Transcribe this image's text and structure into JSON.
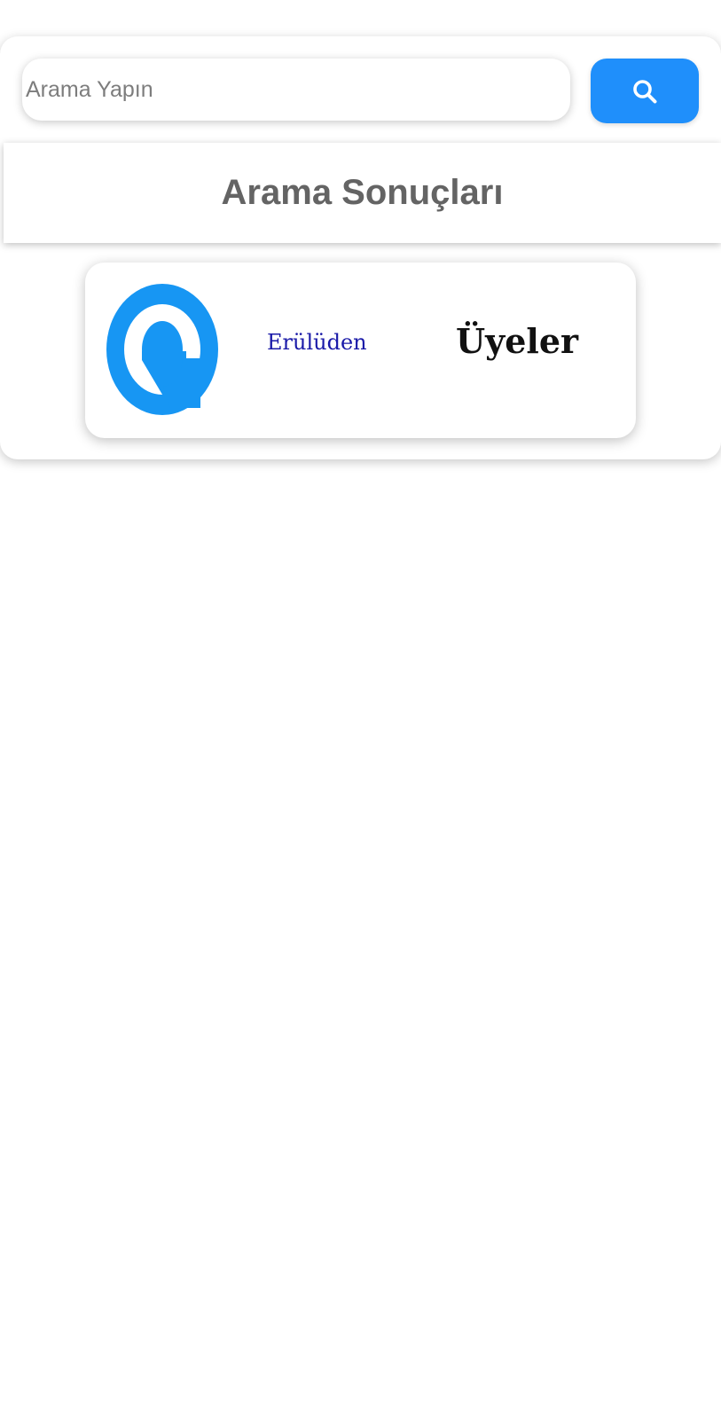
{
  "search": {
    "placeholder": "Arama Yapın",
    "value": "",
    "button_icon": "search-icon",
    "button_color": "#1f8ffb"
  },
  "results": {
    "title": "Arama Sonuçları",
    "items": [
      {
        "logo_icon": "eruluden-logo-icon",
        "logo_color": "#1796f3",
        "name": "Erülüden",
        "type": "Üyeler"
      }
    ]
  }
}
